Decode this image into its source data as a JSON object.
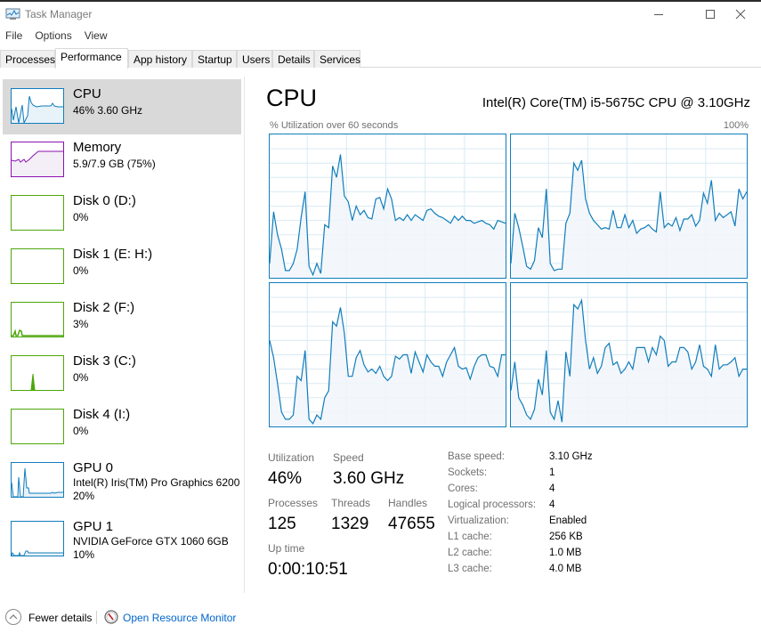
{
  "window": {
    "title": "Task Manager",
    "icon": "task-manager-icon",
    "controls": [
      "minimize-icon",
      "maximize-icon",
      "close-icon"
    ]
  },
  "menu": [
    "File",
    "Options",
    "View"
  ],
  "tabs": [
    {
      "label": "Processes",
      "active": false
    },
    {
      "label": "Performance",
      "active": true
    },
    {
      "label": "App history",
      "active": false
    },
    {
      "label": "Startup",
      "active": false
    },
    {
      "label": "Users",
      "active": false
    },
    {
      "label": "Details",
      "active": false
    },
    {
      "label": "Services",
      "active": false
    }
  ],
  "sidebar": {
    "items": [
      {
        "name": "CPU",
        "sub1": "46% 3.60 GHz",
        "sub2": "",
        "color": "#117dbb",
        "selected": true
      },
      {
        "name": "Memory",
        "sub1": "5.9/7.9 GB (75%)",
        "sub2": "",
        "color": "#8b12ae",
        "selected": false
      },
      {
        "name": "Disk 0 (D:)",
        "sub1": "0%",
        "sub2": "",
        "color": "#4da60c",
        "selected": false
      },
      {
        "name": "Disk 1 (E: H:)",
        "sub1": "0%",
        "sub2": "",
        "color": "#4da60c",
        "selected": false
      },
      {
        "name": "Disk 2 (F:)",
        "sub1": "3%",
        "sub2": "",
        "color": "#4da60c",
        "selected": false
      },
      {
        "name": "Disk 3 (C:)",
        "sub1": "0%",
        "sub2": "",
        "color": "#4da60c",
        "selected": false
      },
      {
        "name": "Disk 4 (I:)",
        "sub1": "0%",
        "sub2": "",
        "color": "#4da60c",
        "selected": false
      },
      {
        "name": "GPU 0",
        "sub1": "Intel(R) Iris(TM) Pro Graphics 6200",
        "sub2": "20%",
        "color": "#117dbb",
        "selected": false
      },
      {
        "name": "GPU 1",
        "sub1": "NVIDIA GeForce GTX 1060 6GB",
        "sub2": "10%",
        "color": "#117dbb",
        "selected": false
      }
    ]
  },
  "main": {
    "title": "CPU",
    "model": "Intel(R) Core(TM) i5-5675C CPU @ 3.10GHz",
    "graph_label": "% Utilization over 60 seconds",
    "graph_max": "100%",
    "stats": {
      "utilization_label": "Utilization",
      "utilization": "46%",
      "speed_label": "Speed",
      "speed": "3.60 GHz",
      "processes_label": "Processes",
      "processes": "125",
      "threads_label": "Threads",
      "threads": "1329",
      "handles_label": "Handles",
      "handles": "47655",
      "uptime_label": "Up time",
      "uptime": "0:00:10:51"
    },
    "specs": [
      {
        "label": "Base speed:",
        "value": "3.10 GHz"
      },
      {
        "label": "Sockets:",
        "value": "1"
      },
      {
        "label": "Cores:",
        "value": "4"
      },
      {
        "label": "Logical processors:",
        "value": "4"
      },
      {
        "label": "Virtualization:",
        "value": "Enabled"
      },
      {
        "label": "L1 cache:",
        "value": "256 KB"
      },
      {
        "label": "L2 cache:",
        "value": "1.0 MB"
      },
      {
        "label": "L3 cache:",
        "value": "4.0 MB"
      }
    ]
  },
  "footer": {
    "fewer_details": "Fewer details",
    "open_resource_monitor": "Open Resource Monitor"
  },
  "colors": {
    "cpu": "#117dbb",
    "cpu_fill": "#f1f6fa",
    "grid": "#d9eaf4",
    "memory": "#8b12ae",
    "disk": "#4da60c",
    "link": "#0066cc",
    "selected_bg": "#d9d9d9"
  },
  "chart_data": {
    "type": "line",
    "title": "% Utilization over 60 seconds",
    "ylim": [
      0,
      100
    ],
    "ylabel_max": "100%",
    "grid": true,
    "series": [
      {
        "name": "core-0",
        "values": [
          10,
          46,
          30,
          20,
          5,
          5,
          10,
          20,
          42,
          60,
          8,
          2,
          10,
          3,
          37,
          35,
          78,
          70,
          86,
          57,
          53,
          40,
          50,
          44,
          47,
          42,
          41,
          55,
          56,
          48,
          62,
          55,
          40,
          42,
          40,
          44,
          40,
          44,
          42,
          40,
          47,
          48,
          45,
          43,
          42,
          40,
          38,
          43,
          40,
          43,
          40,
          40,
          38,
          39,
          40,
          38,
          37,
          34,
          40,
          39,
          38
        ]
      },
      {
        "name": "core-1",
        "values": [
          10,
          45,
          35,
          22,
          8,
          6,
          12,
          35,
          28,
          62,
          10,
          5,
          6,
          6,
          38,
          45,
          80,
          75,
          82,
          55,
          45,
          40,
          37,
          34,
          35,
          34,
          47,
          35,
          35,
          44,
          35,
          40,
          31,
          34,
          35,
          37,
          34,
          32,
          60,
          35,
          38,
          36,
          42,
          33,
          41,
          41,
          44,
          36,
          40,
          59,
          52,
          68,
          40,
          45,
          42,
          44,
          46,
          36,
          62,
          55,
          60
        ]
      },
      {
        "name": "core-2",
        "values": [
          60,
          48,
          30,
          10,
          5,
          5,
          8,
          35,
          32,
          53,
          5,
          2,
          8,
          5,
          20,
          25,
          73,
          70,
          83,
          65,
          35,
          35,
          48,
          53,
          43,
          38,
          40,
          37,
          42,
          35,
          32,
          35,
          49,
          47,
          50,
          50,
          37,
          52,
          45,
          38,
          50,
          45,
          42,
          42,
          35,
          45,
          50,
          55,
          42,
          40,
          41,
          33,
          42,
          48,
          50,
          50,
          42,
          41,
          35,
          50,
          50
        ]
      },
      {
        "name": "core-3",
        "values": [
          25,
          45,
          20,
          15,
          8,
          5,
          12,
          33,
          22,
          53,
          10,
          5,
          18,
          3,
          52,
          35,
          85,
          82,
          88,
          60,
          40,
          48,
          37,
          42,
          55,
          58,
          43,
          45,
          37,
          40,
          45,
          40,
          55,
          55,
          55,
          45,
          55,
          50,
          63,
          60,
          42,
          45,
          45,
          55,
          55,
          52,
          40,
          45,
          57,
          42,
          40,
          35,
          57,
          40,
          43,
          43,
          45,
          48,
          35,
          40,
          40
        ]
      }
    ]
  }
}
